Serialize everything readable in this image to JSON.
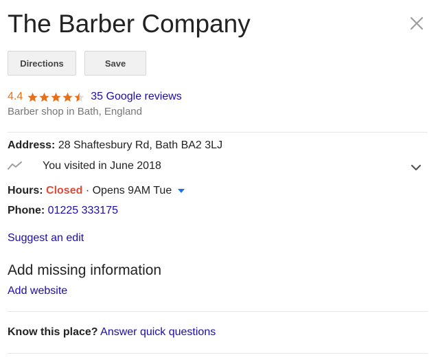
{
  "place": {
    "name": "The Barber Company",
    "category": "Barber shop in Bath, England"
  },
  "actions": {
    "directions_label": "Directions",
    "save_label": "Save"
  },
  "rating": {
    "value": "4.4",
    "stars": 4.4,
    "reviews_label": "35 Google reviews",
    "star_color": "#e7711b"
  },
  "address": {
    "label": "Address:",
    "value": "28 Shaftesbury Rd, Bath BA2 3LJ"
  },
  "visit": {
    "text": "You visited in June 2018"
  },
  "hours": {
    "label": "Hours:",
    "status": "Closed",
    "separator": "·",
    "opens": "Opens 9AM Tue",
    "status_color": "#dd4b39"
  },
  "phone": {
    "label": "Phone:",
    "value": "01225 333175"
  },
  "suggest_edit_label": "Suggest an edit",
  "missing_info": {
    "heading": "Add missing information",
    "add_website_label": "Add website"
  },
  "know_place": {
    "label": "Know this place?",
    "link_label": "Answer quick questions"
  },
  "colors": {
    "link": "#1a0dab",
    "divider": "#e6e6e6",
    "secondary_text": "#777777"
  },
  "icons": {
    "close": "close-icon",
    "visit": "visit-trend-icon",
    "expand": "chevron-down-icon",
    "hours_dropdown": "caret-down-icon",
    "star": "star-icon"
  }
}
